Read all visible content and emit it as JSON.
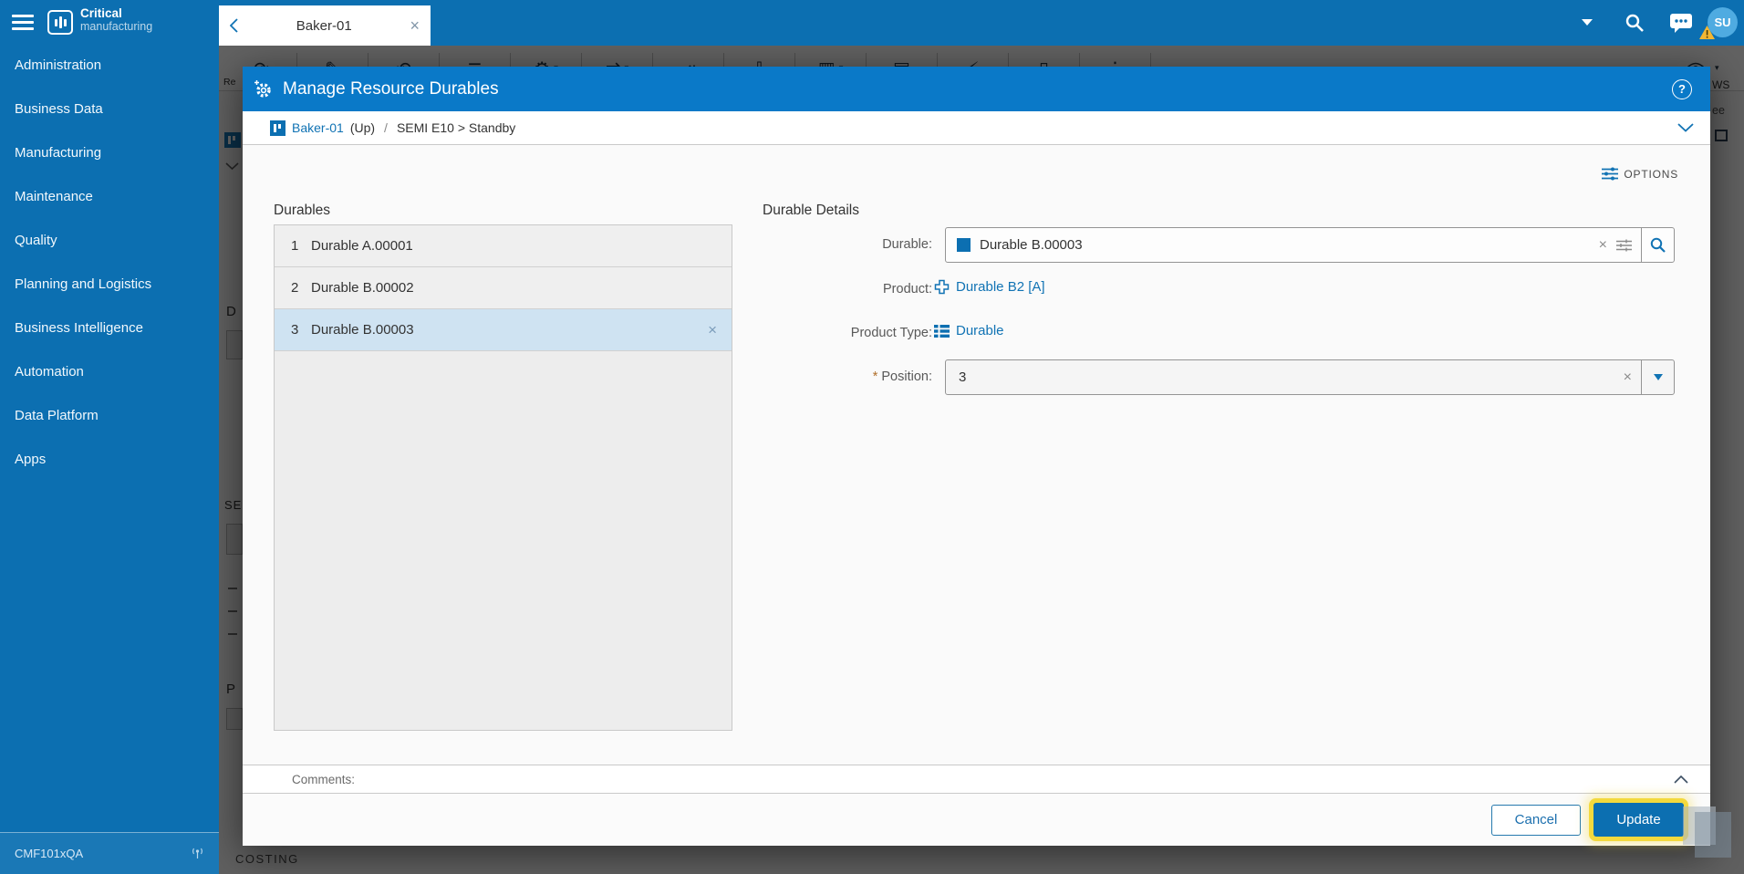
{
  "colors": {
    "brand_blue": "#0c6fb1",
    "modal_header_blue": "#0a79c8",
    "link_blue": "#1173b4",
    "selected_row": "#cfe3f2",
    "highlight_yellow": "#f3d93d",
    "avatar_blue": "#4fabe1",
    "warning_yellow": "#f2b632",
    "required_orange": "#b06f2a"
  },
  "sidebar": {
    "brand_bold": "Critical",
    "brand_light": "manufacturing",
    "items": [
      "Administration",
      "Business Data",
      "Manufacturing",
      "Maintenance",
      "Quality",
      "Planning and Logistics",
      "Business Intelligence",
      "Automation",
      "Data Platform",
      "Apps"
    ],
    "environment": "CMF101xQA"
  },
  "topbar": {
    "tab_title": "Baker-01",
    "avatar_initials": "SU"
  },
  "modal": {
    "title": "Manage Resource Durables",
    "breadcrumb": {
      "entity": "Baker-01",
      "state": "(Up)",
      "separator": "/",
      "path": "SEMI E10 > Standby"
    },
    "options_label": "OPTIONS",
    "durables_panel": {
      "title": "Durables",
      "rows": [
        {
          "index": "1",
          "name": "Durable A.00001"
        },
        {
          "index": "2",
          "name": "Durable B.00002"
        },
        {
          "index": "3",
          "name": "Durable B.00003"
        }
      ]
    },
    "details_panel": {
      "title": "Durable Details",
      "durable_label": "Durable:",
      "durable_value": "Durable B.00003",
      "product_label": "Product:",
      "product_value": "Durable B2 [A]",
      "product_type_label": "Product Type:",
      "product_type_value": "Durable",
      "position_required_mark": "*",
      "position_label": "Position:",
      "position_value": "3"
    },
    "comments_label": "Comments:",
    "footer": {
      "cancel_label": "Cancel",
      "update_label": "Update"
    }
  },
  "background": {
    "toolbar": [
      {
        "name": "refresh-icon",
        "glyph": "⟳"
      },
      {
        "name": "edit-icon",
        "glyph": "✎"
      },
      {
        "name": "cycle-icon",
        "glyph": "⟲"
      },
      {
        "name": "checklist-icon",
        "glyph": "≣"
      },
      {
        "name": "setup-gears-icon",
        "glyph": "⚙"
      },
      {
        "name": "transfer-icon",
        "glyph": "⇄"
      },
      {
        "name": "dispatch-icon",
        "glyph": "⇥"
      },
      {
        "name": "download-icon",
        "glyph": "⇩"
      },
      {
        "name": "chart-icon",
        "glyph": "▥"
      },
      {
        "name": "queue-icon",
        "glyph": "▤"
      },
      {
        "name": "actions-icon",
        "glyph": "⚡"
      },
      {
        "name": "document-icon",
        "glyph": "▯"
      },
      {
        "name": "more-icon",
        "glyph": "⋮"
      }
    ],
    "left_fragments": {
      "f1": "Re",
      "f2": "D",
      "f3": "SE",
      "f4": "P",
      "costing": "COSTING"
    },
    "right_fragments": {
      "f1": "WS",
      "f2": "ee"
    }
  },
  "glyphs": {
    "close": "×",
    "clear": "×",
    "help": "?",
    "caret_down": "▾"
  }
}
